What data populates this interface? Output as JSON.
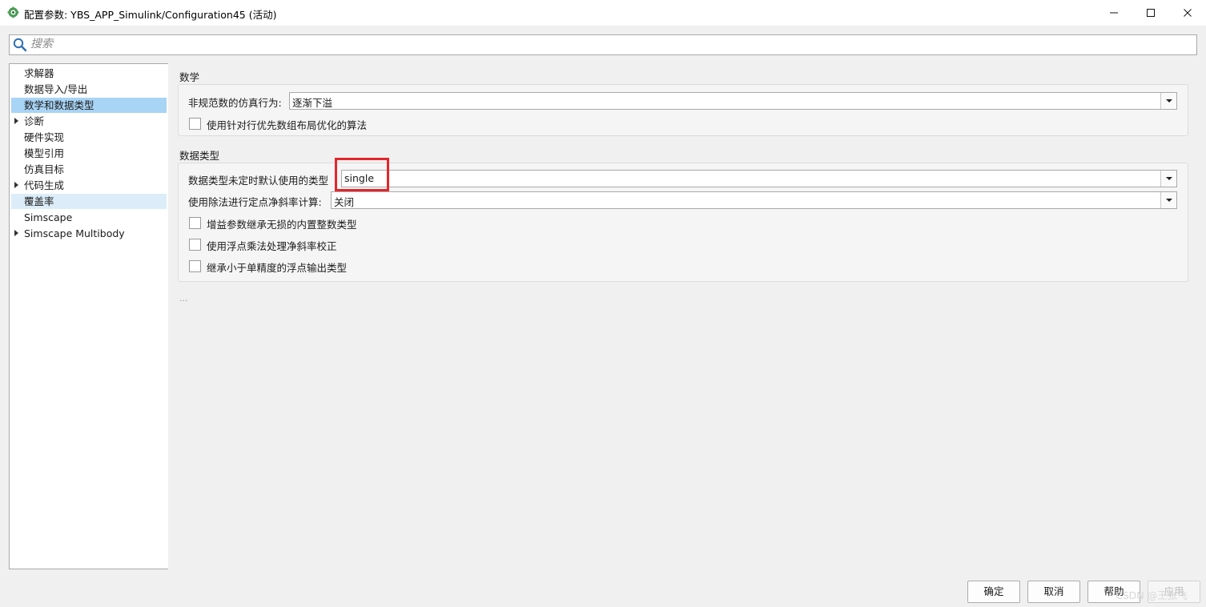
{
  "window": {
    "title": "配置参数: YBS_APP_Simulink/Configuration45 (活动)",
    "minimize_label": "—",
    "maximize_label": "☐",
    "close_label": "✕"
  },
  "search": {
    "placeholder": "搜索",
    "value": ""
  },
  "tree": {
    "items": [
      {
        "label": "求解器",
        "expandable": false,
        "state": "normal"
      },
      {
        "label": "数据导入/导出",
        "expandable": false,
        "state": "normal"
      },
      {
        "label": "数学和数据类型",
        "expandable": false,
        "state": "selected"
      },
      {
        "label": "诊断",
        "expandable": true,
        "state": "normal"
      },
      {
        "label": "硬件实现",
        "expandable": false,
        "state": "normal"
      },
      {
        "label": "模型引用",
        "expandable": false,
        "state": "normal"
      },
      {
        "label": "仿真目标",
        "expandable": false,
        "state": "normal"
      },
      {
        "label": "代码生成",
        "expandable": true,
        "state": "normal"
      },
      {
        "label": "覆盖率",
        "expandable": false,
        "state": "hover"
      },
      {
        "label": "Simscape",
        "expandable": false,
        "state": "normal"
      },
      {
        "label": "Simscape Multibody",
        "expandable": true,
        "state": "normal"
      }
    ]
  },
  "math": {
    "section_title": "数学",
    "denormal_label": "非规范数的仿真行为:",
    "denormal_value": "逐渐下溢",
    "row_major_label": "使用针对行优先数组布局优化的算法",
    "row_major_checked": false
  },
  "datatypes": {
    "section_title": "数据类型",
    "default_type_label": "数据类型未定时默认使用的类型",
    "default_type_value": "single",
    "division_label": "使用除法进行定点净斜率计算:",
    "division_value": "关闭",
    "checkboxes": [
      {
        "label": "增益参数继承无损的内置整数类型",
        "checked": false
      },
      {
        "label": "使用浮点乘法处理净斜率校正",
        "checked": false
      },
      {
        "label": "继承小于单精度的浮点输出类型",
        "checked": false
      }
    ],
    "more": "..."
  },
  "buttons": {
    "ok": "确定",
    "cancel": "取消",
    "help": "帮助",
    "apply": "应用"
  },
  "watermark": "CSDN @王张飞",
  "colors": {
    "selected": "#a8d4f5",
    "hover": "#dcedf9",
    "highlight": "#e3262b"
  }
}
